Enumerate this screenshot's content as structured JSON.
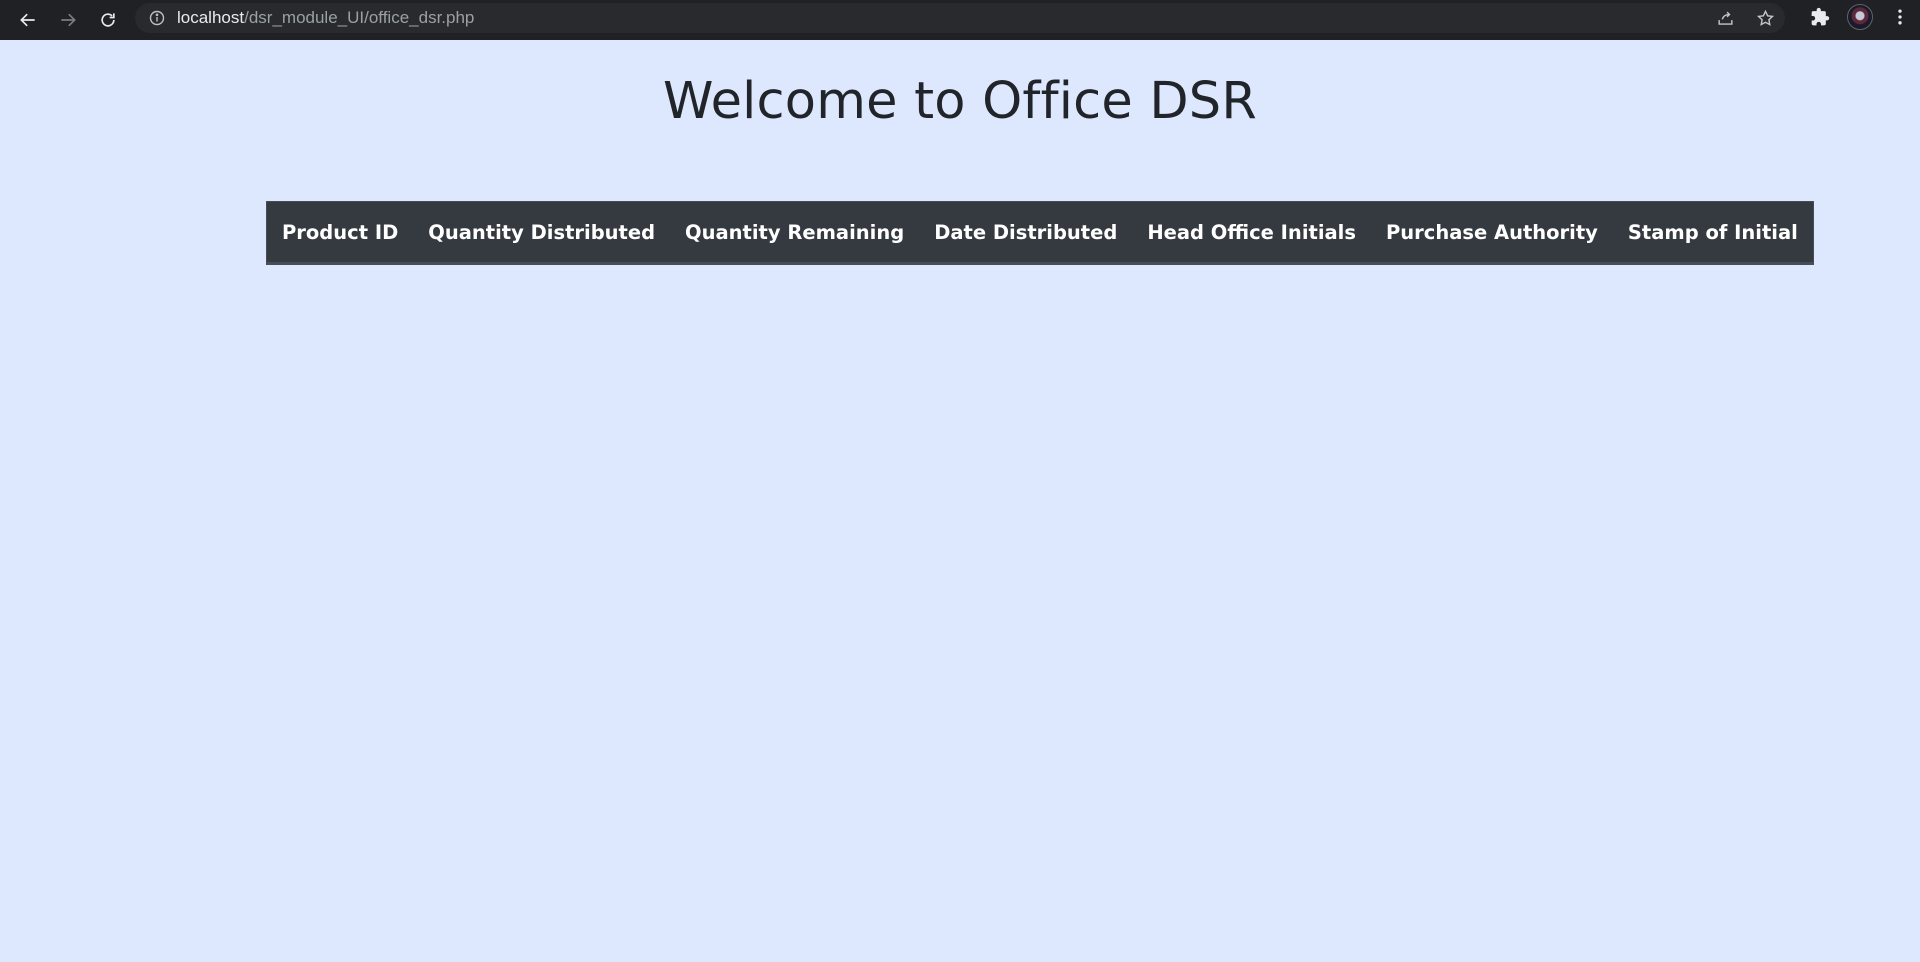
{
  "browser": {
    "url_host": "localhost",
    "url_path": "/dsr_module_UI/office_dsr.php",
    "icons": [
      "back-icon",
      "forward-icon",
      "reload-icon",
      "info-icon",
      "share-icon",
      "bookmark-star-icon",
      "extensions-icon",
      "profile-avatar",
      "menu-icon"
    ]
  },
  "page": {
    "title": "Welcome to Office DSR"
  },
  "table": {
    "headers": [
      "Product ID",
      "Quantity Distributed",
      "Quantity Remaining",
      "Date Distributed",
      "Head Office Initials",
      "Purchase Authority",
      "Stamp of Initial"
    ],
    "rows": []
  },
  "colors": {
    "page_background": "#dde8ff",
    "table_header_background": "#343a40",
    "title_text": "#212529"
  }
}
